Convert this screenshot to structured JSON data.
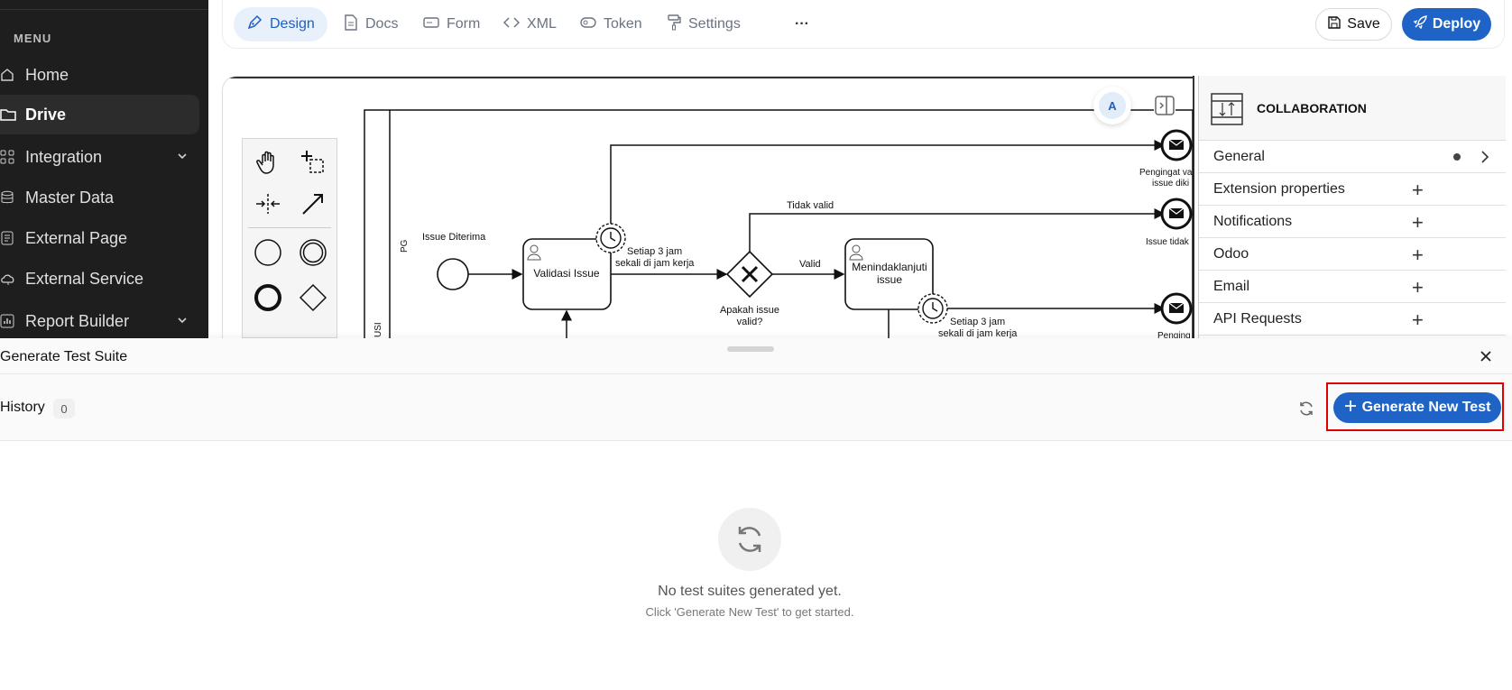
{
  "sidebar": {
    "menu_label": "MENU",
    "items": [
      {
        "label": "Home",
        "icon": "home-icon"
      },
      {
        "label": "Drive",
        "icon": "folder-icon"
      },
      {
        "label": "Integration",
        "icon": "grid-icon"
      },
      {
        "label": "Master Data",
        "icon": "database-icon"
      },
      {
        "label": "External Page",
        "icon": "page-icon"
      },
      {
        "label": "External Service",
        "icon": "cloud-icon"
      },
      {
        "label": "Report Builder",
        "icon": "chart-icon"
      }
    ]
  },
  "toolbar": {
    "tabs": [
      {
        "label": "Design",
        "icon": "pen-icon"
      },
      {
        "label": "Docs",
        "icon": "document-icon"
      },
      {
        "label": "Form",
        "icon": "form-icon"
      },
      {
        "label": "XML",
        "icon": "code-icon"
      },
      {
        "label": "Token",
        "icon": "token-icon"
      },
      {
        "label": "Settings",
        "icon": "paint-roller-icon"
      }
    ],
    "more": "···",
    "save_label": "Save",
    "deploy_label": "Deploy"
  },
  "diagram": {
    "avatar": "A",
    "lane_label": "PG",
    "lane_label_2": "USI",
    "start_event": "Issue Diterima",
    "task_1": "Validasi Issue",
    "timer_1": [
      "Setiap 3 jam",
      "sekali di jam kerja"
    ],
    "gateway_label": [
      "Apakah issue",
      "valid?"
    ],
    "flow_invalid": "Tidak valid",
    "flow_valid": "Valid",
    "task_2": [
      "Menindaklanjuti",
      "issue"
    ],
    "timer_2": [
      "Setiap 3 jam",
      "sekali di jam kerja"
    ],
    "end_1": [
      "Pengingat va",
      "issue diki"
    ],
    "end_2": "Issue tidak",
    "end_3": "Penging"
  },
  "properties": {
    "title": "COLLABORATION",
    "rows": [
      {
        "label": "General",
        "kind": "expand"
      },
      {
        "label": "Extension properties",
        "kind": "add"
      },
      {
        "label": "Notifications",
        "kind": "add"
      },
      {
        "label": "Odoo",
        "kind": "add"
      },
      {
        "label": "Email",
        "kind": "add"
      },
      {
        "label": "API Requests",
        "kind": "add"
      }
    ]
  },
  "suite": {
    "title": "Generate Test Suite",
    "history_label": "History",
    "history_count": "0",
    "generate_label": "Generate New Test",
    "empty_title": "No test suites generated yet.",
    "empty_sub": "Click 'Generate New Test' to get started."
  },
  "colors": {
    "accent": "#1f63c6",
    "sidebar_bg": "#1e1e1e",
    "highlight": "#e00000"
  }
}
